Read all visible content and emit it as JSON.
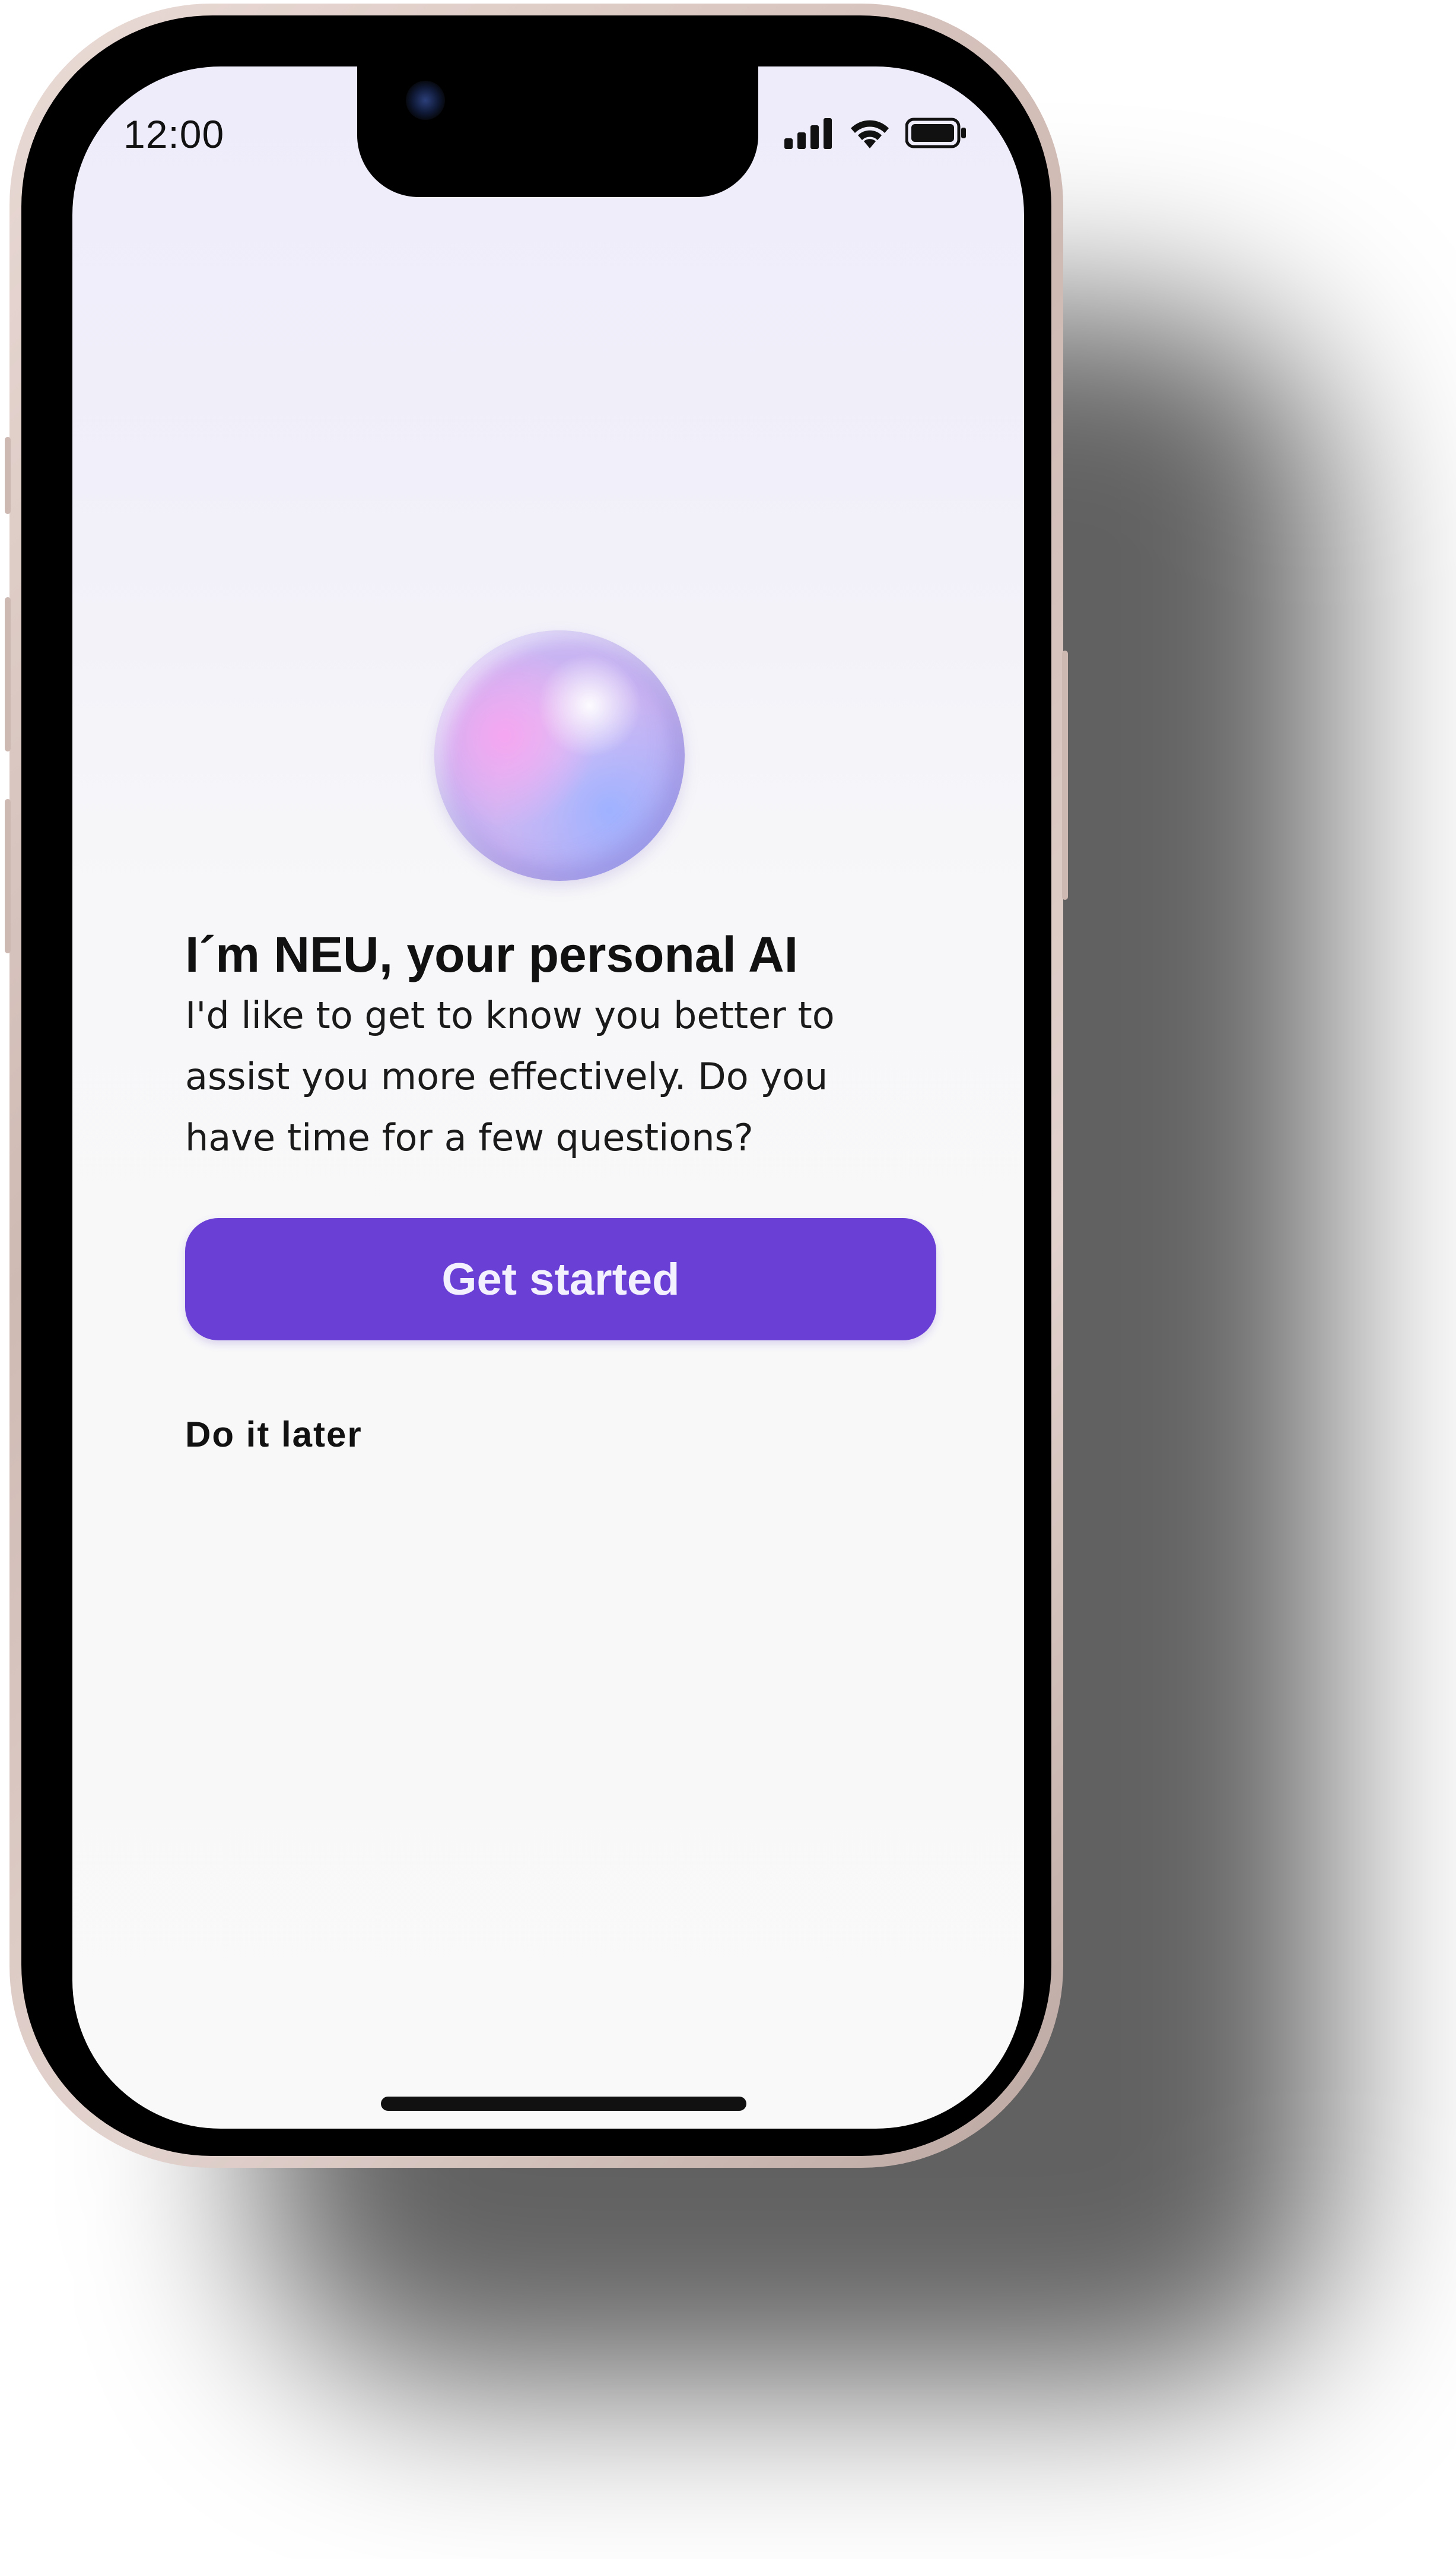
{
  "status_bar": {
    "time": "12:00",
    "signal_icon": "cellular-signal-icon",
    "wifi_icon": "wifi-icon",
    "battery_icon": "battery-full-icon"
  },
  "assistant": {
    "avatar_icon": "ai-orb-avatar"
  },
  "onboarding": {
    "title": "I´m NEU, your personal AI",
    "message": "I'd like to get to know you better to assist you more effectively. Do you have time for a few questions?",
    "primary_label": "Get started",
    "secondary_label": "Do it later"
  },
  "colors": {
    "accent": "#6a3fd6",
    "text": "#111111",
    "background": "#f9f9f9"
  }
}
